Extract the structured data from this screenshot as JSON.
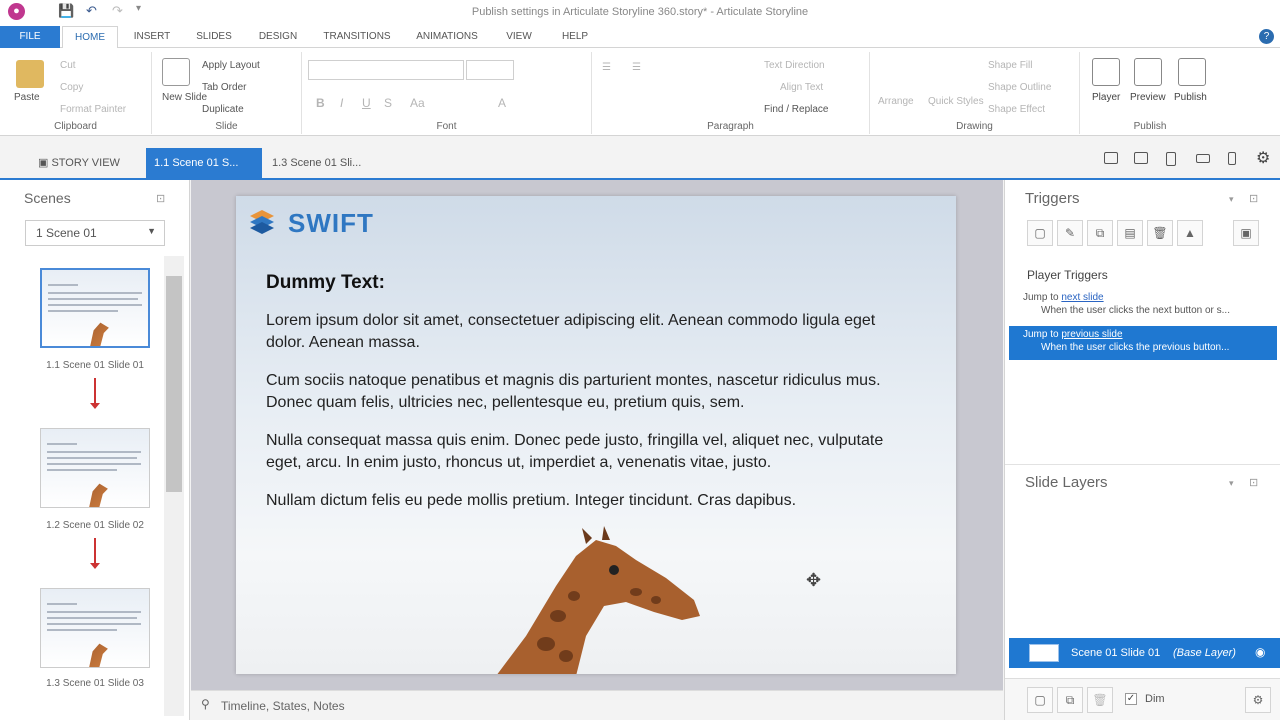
{
  "window": {
    "title": "Publish settings in Articulate Storyline 360.story* - Articulate Storyline"
  },
  "ribbon_tabs": [
    {
      "label": "FILE"
    },
    {
      "label": "HOME"
    },
    {
      "label": "INSERT"
    },
    {
      "label": "SLIDES"
    },
    {
      "label": "DESIGN"
    },
    {
      "label": "TRANSITIONS"
    },
    {
      "label": "ANIMATIONS"
    },
    {
      "label": "VIEW"
    },
    {
      "label": "HELP"
    }
  ],
  "ribbon": {
    "clipboard": {
      "paste": "Paste",
      "cut": "Cut",
      "copy": "Copy",
      "format_painter": "Format Painter",
      "label": "Clipboard"
    },
    "slide": {
      "new_slide": "New Slide",
      "apply_layout": "Apply Layout",
      "tab_order": "Tab Order",
      "duplicate": "Duplicate",
      "label": "Slide"
    },
    "font": {
      "label": "Font"
    },
    "paragraph": {
      "text_direction": "Text Direction",
      "align_text": "Align Text",
      "find_replace": "Find / Replace",
      "label": "Paragraph"
    },
    "drawing": {
      "arrange": "Arrange",
      "quick_styles": "Quick Styles",
      "shape_fill": "Shape Fill",
      "shape_outline": "Shape Outline",
      "shape_effect": "Shape Effect",
      "label": "Drawing"
    },
    "publish": {
      "player": "Player",
      "preview": "Preview",
      "publish": "Publish",
      "label": "Publish"
    }
  },
  "view_tabs": [
    {
      "label": "STORY VIEW"
    },
    {
      "label": "1.1 Scene 01 S..."
    },
    {
      "label": "1.3 Scene 01 Sli..."
    }
  ],
  "scenes_panel": {
    "title": "Scenes",
    "selected_scene": "1 Scene 01",
    "slides": [
      {
        "label": "1.1 Scene 01 Slide 01"
      },
      {
        "label": "1.2 Scene 01 Slide 02"
      },
      {
        "label": "1.3 Scene 01 Slide 03"
      }
    ]
  },
  "slide": {
    "logo_text": "SWIFT",
    "heading": "Dummy Text:",
    "paragraphs": [
      "Lorem ipsum dolor sit amet, consectetuer adipiscing elit. Aenean commodo ligula eget dolor. Aenean massa.",
      "Cum sociis natoque penatibus et magnis dis parturient montes, nascetur ridiculus mus. Donec quam felis, ultricies nec, pellentesque eu, pretium quis, sem.",
      "Nulla consequat massa quis enim. Donec pede justo, fringilla vel, aliquet nec, vulputate eget, arcu. In enim justo, rhoncus ut, imperdiet a, venenatis vitae, justo.",
      "Nullam dictum felis eu pede mollis pretium. Integer tincidunt. Cras dapibus."
    ]
  },
  "bottom_bar": {
    "label": "Timeline, States, Notes"
  },
  "triggers_panel": {
    "title": "Triggers",
    "group": "Player Triggers",
    "items": [
      {
        "action": "Jump to",
        "target": "next slide",
        "condition": "When the user clicks the next button or s..."
      },
      {
        "action": "Jump to",
        "target": "previous slide",
        "condition": "When the user clicks the previous button..."
      }
    ]
  },
  "layers_panel": {
    "title": "Slide Layers",
    "base_layer_name": "Scene 01 Slide 01",
    "base_layer_tag": "(Base Layer)",
    "dim_label": "Dim"
  },
  "colors": {
    "accent": "#2b7bd1",
    "selection": "#1f78d1",
    "link": "#2a64c2",
    "arrow": "#cc3333"
  }
}
